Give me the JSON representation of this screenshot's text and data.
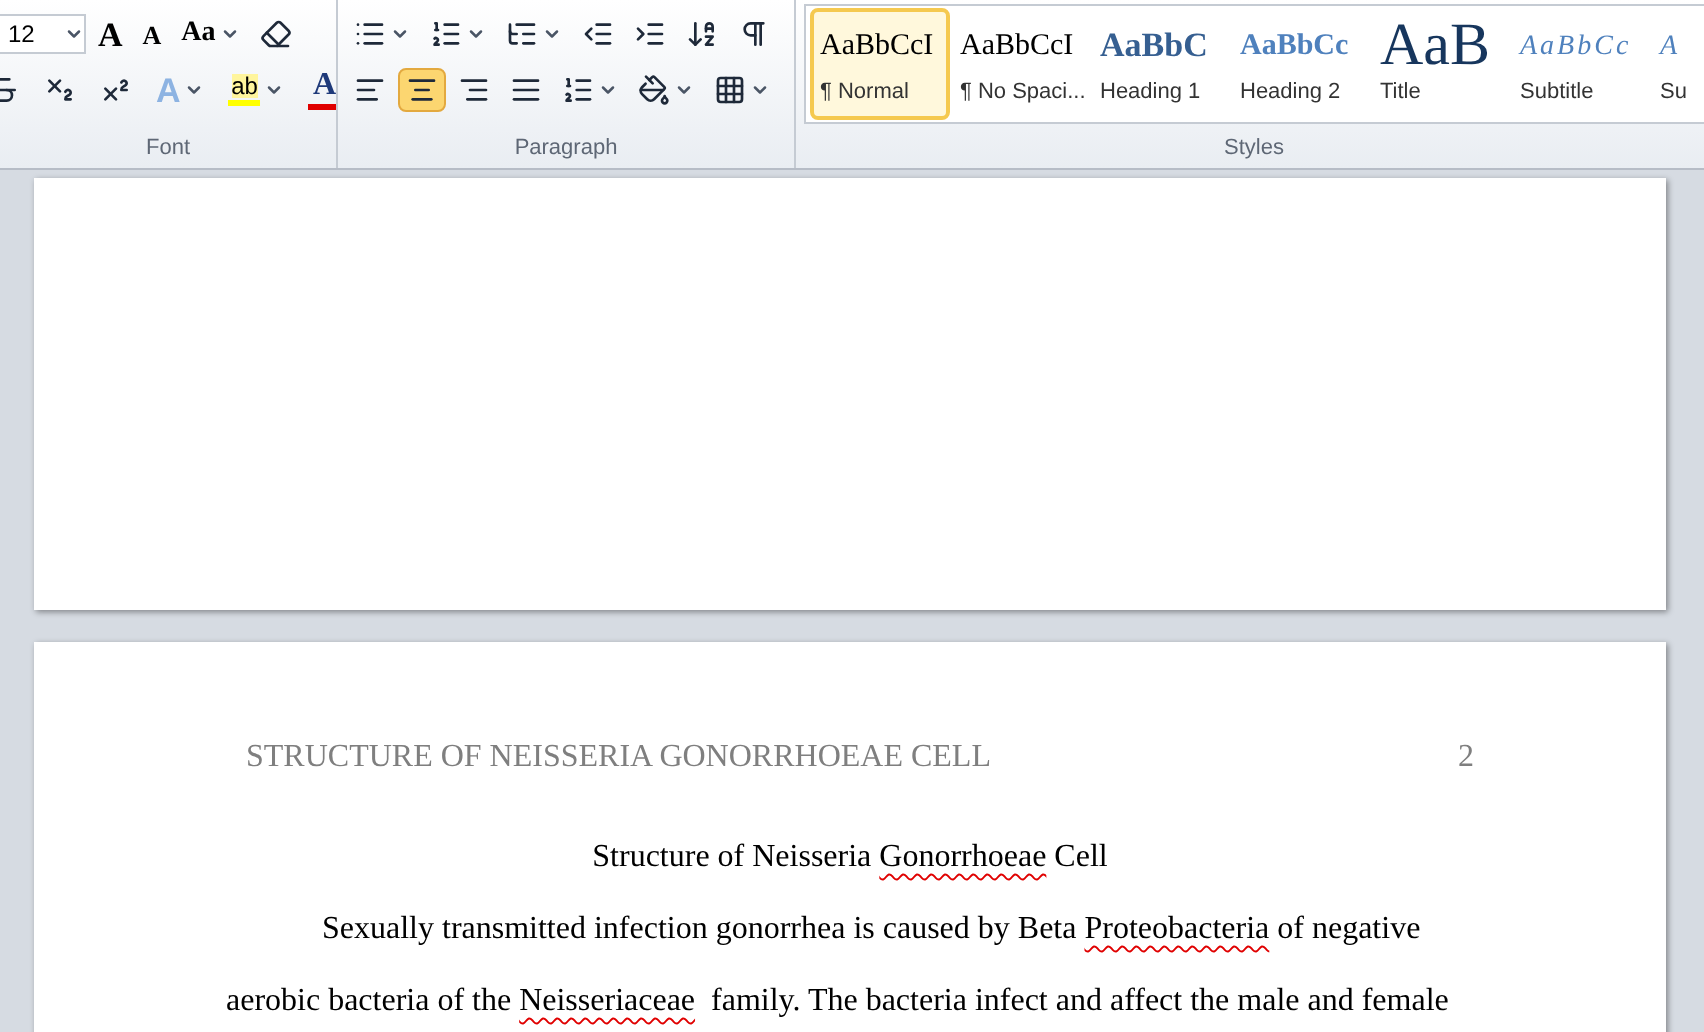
{
  "ribbon": {
    "font_group": {
      "label": "Font",
      "font_size": "12",
      "row1": [
        {
          "kind": "grow",
          "glyph": "A"
        },
        {
          "kind": "shrink",
          "glyph": "A"
        },
        {
          "kind": "case",
          "glyph": "Aa"
        },
        {
          "kind": "clear"
        }
      ],
      "row2": [
        {
          "kind": "strike"
        },
        {
          "kind": "subscript"
        },
        {
          "kind": "superscript"
        },
        {
          "kind": "effects",
          "glyph": "A"
        },
        {
          "kind": "highlight",
          "glyph": "ab",
          "color": "#ffff00"
        },
        {
          "kind": "font_color",
          "glyph": "A",
          "color": "#e00000"
        }
      ]
    },
    "paragraph_group": {
      "label": "Paragraph",
      "row1": [
        {
          "kind": "bullets"
        },
        {
          "kind": "numbering"
        },
        {
          "kind": "multilevel"
        },
        {
          "kind": "decrease_indent"
        },
        {
          "kind": "increase_indent"
        },
        {
          "kind": "sort"
        },
        {
          "kind": "show_marks"
        }
      ],
      "alignment": [
        {
          "kind": "left",
          "selected": false
        },
        {
          "kind": "center",
          "selected": true
        },
        {
          "kind": "right",
          "selected": false
        },
        {
          "kind": "justify",
          "selected": false
        }
      ],
      "row2": [
        {
          "kind": "line_spacing"
        },
        {
          "kind": "shading"
        },
        {
          "kind": "borders"
        }
      ]
    },
    "styles_group": {
      "label": "Styles",
      "items": [
        {
          "preview": "AaBbCcI",
          "name": "¶ Normal",
          "kind": "normal",
          "selected": true
        },
        {
          "preview": "AaBbCcI",
          "name": "¶ No Spaci...",
          "kind": "normal",
          "selected": false
        },
        {
          "preview": "AaBbC",
          "name": "Heading 1",
          "kind": "heading1",
          "selected": false
        },
        {
          "preview": "AaBbCc",
          "name": "Heading 2",
          "kind": "heading2",
          "selected": false
        },
        {
          "preview": "AaB",
          "name": "Title",
          "kind": "title",
          "selected": false
        },
        {
          "preview": "AaBbCc",
          "name": "Subtitle",
          "kind": "subtitle",
          "selected": false
        },
        {
          "preview": "A",
          "name": "Su",
          "kind": "subtitle",
          "selected": false
        }
      ]
    }
  },
  "document": {
    "page_2": {
      "header": "STRUCTURE OF NEISSERIA GONORRHOEAE CELL",
      "page_number": "2",
      "title": [
        {
          "text": "Structure of Neisseria ",
          "misspelled": false
        },
        {
          "text": "Gonorrhoeae",
          "misspelled": true
        },
        {
          "text": " Cell",
          "misspelled": false
        }
      ],
      "paragraph": [
        {
          "text": "Sexually transmitted infection gonorrhea is caused by Beta ",
          "misspelled": false
        },
        {
          "text": "Proteobacteria",
          "misspelled": true
        },
        {
          "text": " of negative aerobic bacteria of the ",
          "misspelled": false
        },
        {
          "text": "Neisseriaceae",
          "misspelled": true
        },
        {
          "text": "  family. The bacteria infect and affect the male and female",
          "misspelled": false
        }
      ]
    }
  }
}
